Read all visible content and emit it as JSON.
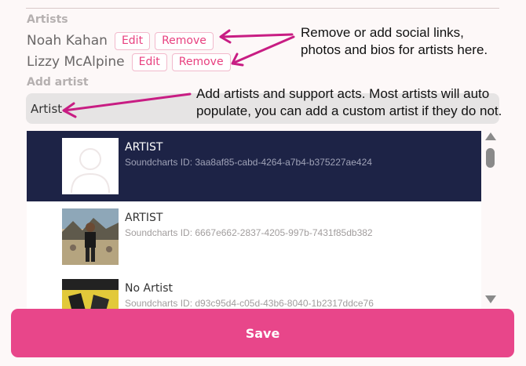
{
  "artists_section": {
    "label": "Artists",
    "artists": [
      {
        "name": "Noah Kahan",
        "edit_label": "Edit",
        "remove_label": "Remove"
      },
      {
        "name": "Lizzy McAlpine",
        "edit_label": "Edit",
        "remove_label": "Remove"
      }
    ]
  },
  "add_artist": {
    "label": "Add artist",
    "search_value": "Artist"
  },
  "results": [
    {
      "title": "ARTIST",
      "subtitle": "Soundcharts ID: 3aa8af85-cabd-4264-a7b4-b375227ae424",
      "selected": true,
      "thumb": "avatar-placeholder"
    },
    {
      "title": "ARTIST",
      "subtitle": "Soundcharts ID: 6667e662-2837-4205-997b-7431f85db382",
      "selected": false,
      "thumb": "photo"
    },
    {
      "title": "No Artist",
      "subtitle": "Soundcharts ID: d93c95d4-c05d-43b6-8040-1b2317ddce76",
      "selected": false,
      "thumb": "photo"
    }
  ],
  "save_label": "Save",
  "annotations": {
    "top": [
      "Remove or add social links,",
      "photos and bios for artists here."
    ],
    "middle": [
      "Add artists and support acts. Most artists will auto",
      "populate, you can add a custom artist if they do not."
    ]
  },
  "colors": {
    "accent": "#e8468a",
    "selected_row": "#1d2346",
    "annotation_arrow": "#c81d83"
  }
}
